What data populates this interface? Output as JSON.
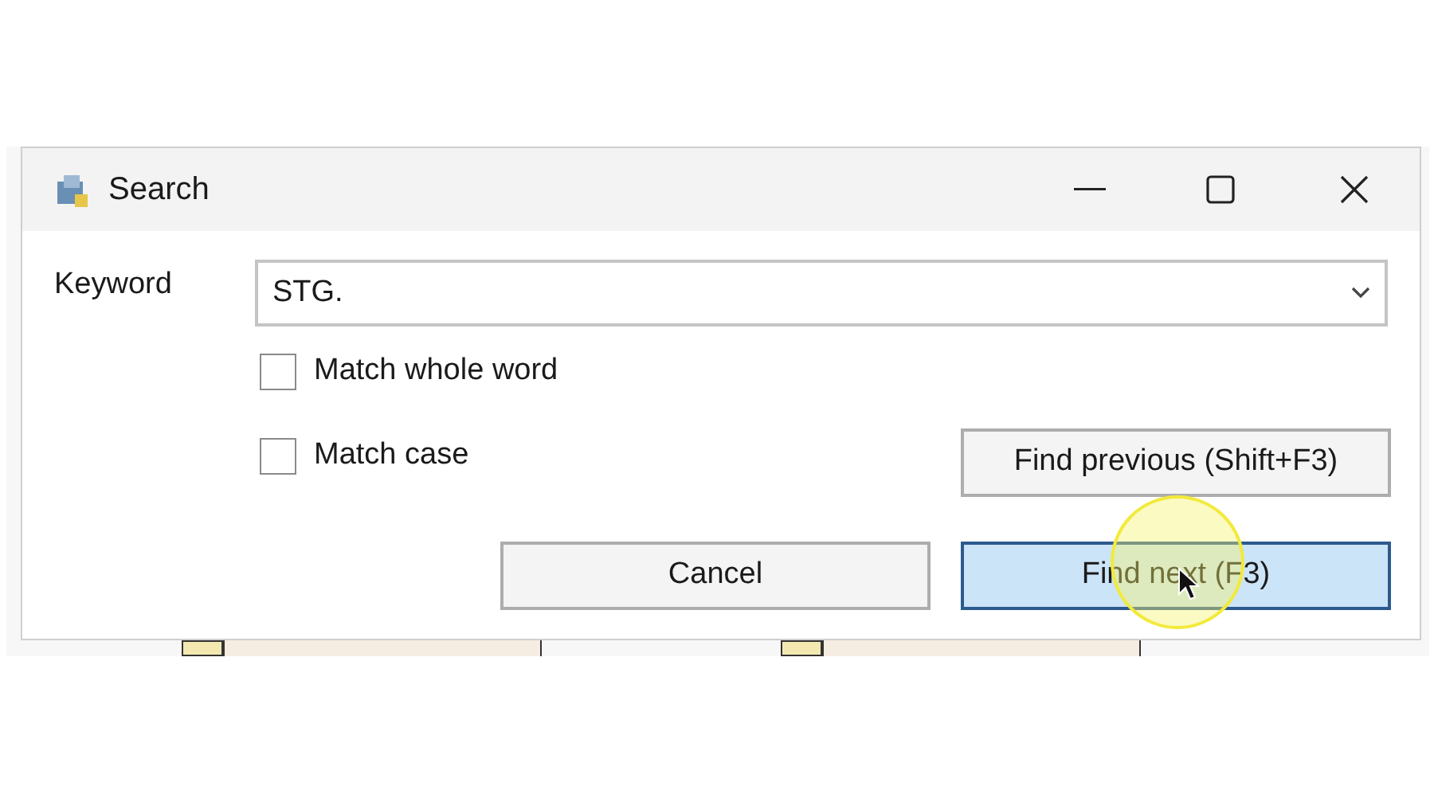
{
  "window": {
    "title": "Search"
  },
  "keyword": {
    "label": "Keyword",
    "value": "STG."
  },
  "options": [
    {
      "label": "Match whole word",
      "checked": false
    },
    {
      "label": "Match case",
      "checked": false
    }
  ],
  "buttons": [
    {
      "label": "Find previous (Shift+F3)",
      "default": false
    },
    {
      "label": "Cancel",
      "default": false
    },
    {
      "label": "Find next (F3)",
      "default": true
    }
  ]
}
